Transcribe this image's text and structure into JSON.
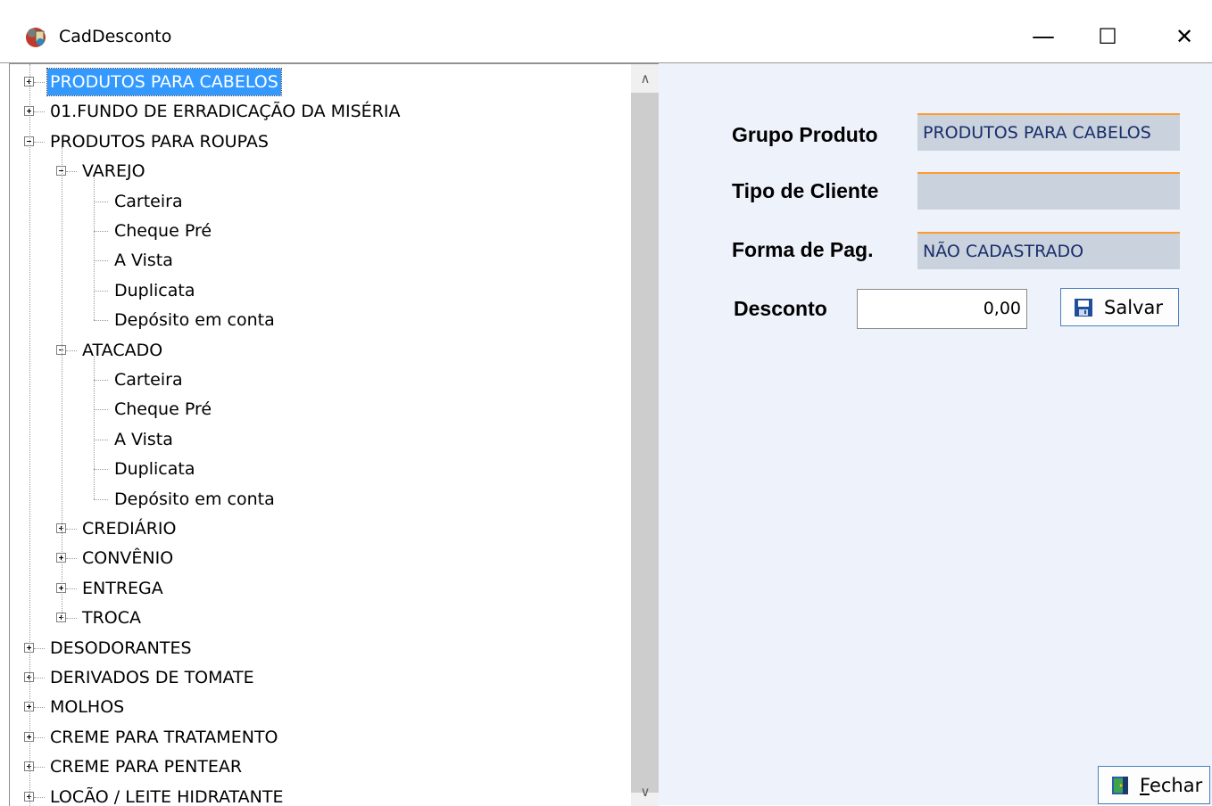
{
  "window": {
    "title": "CadDesconto",
    "controls": {
      "minimize": "—",
      "maximize": "☐",
      "close": "✕"
    }
  },
  "tree": {
    "items": [
      {
        "label": "PRODUTOS PARA CABELOS",
        "level": 0,
        "expander": "plus",
        "selected": true
      },
      {
        "label": "01.FUNDO DE ERRADICAÇÃO DA MISÉRIA",
        "level": 0,
        "expander": "plus"
      },
      {
        "label": "PRODUTOS PARA ROUPAS",
        "level": 0,
        "expander": "minus"
      },
      {
        "label": "VAREJO",
        "level": 1,
        "expander": "minus"
      },
      {
        "label": "Carteira",
        "level": 2
      },
      {
        "label": "Cheque Pré",
        "level": 2
      },
      {
        "label": "A Vista",
        "level": 2
      },
      {
        "label": "Duplicata",
        "level": 2
      },
      {
        "label": "Depósito em conta",
        "level": 2
      },
      {
        "label": "ATACADO",
        "level": 1,
        "expander": "minus"
      },
      {
        "label": "Carteira",
        "level": 2
      },
      {
        "label": "Cheque Pré",
        "level": 2
      },
      {
        "label": "A Vista",
        "level": 2
      },
      {
        "label": "Duplicata",
        "level": 2
      },
      {
        "label": "Depósito em conta",
        "level": 2
      },
      {
        "label": "CREDIÁRIO",
        "level": 1,
        "expander": "plus"
      },
      {
        "label": "CONVÊNIO",
        "level": 1,
        "expander": "plus"
      },
      {
        "label": "ENTREGA",
        "level": 1,
        "expander": "plus"
      },
      {
        "label": "TROCA",
        "level": 1,
        "expander": "plus"
      },
      {
        "label": "DESODORANTES",
        "level": 0,
        "expander": "plus"
      },
      {
        "label": "DERIVADOS DE TOMATE",
        "level": 0,
        "expander": "plus"
      },
      {
        "label": "MOLHOS",
        "level": 0,
        "expander": "plus"
      },
      {
        "label": "CREME PARA TRATAMENTO",
        "level": 0,
        "expander": "plus"
      },
      {
        "label": "CREME PARA PENTEAR",
        "level": 0,
        "expander": "plus"
      },
      {
        "label": "LOCÃO / LEITE HIDRATANTE",
        "level": 0,
        "expander": "plus"
      }
    ]
  },
  "scrollbar": {
    "up": "∧",
    "down": "∨"
  },
  "form": {
    "grupo_produto": {
      "label": "Grupo Produto",
      "value": "PRODUTOS PARA CABELOS"
    },
    "tipo_cliente": {
      "label": "Tipo de Cliente",
      "value": ""
    },
    "forma_pag": {
      "label": "Forma de Pag.",
      "value": "NÃO CADASTRADO"
    },
    "desconto": {
      "label": "Desconto",
      "value": "0,00"
    },
    "salvar": {
      "label": "Salvar"
    },
    "fechar": {
      "label_hotkey": "F",
      "label_rest": "echar"
    }
  },
  "colors": {
    "selection": "#3399ff",
    "panel_bg": "#eef2fb",
    "field_bg": "#c9d2dd",
    "field_accent": "#ff9a2e",
    "field_text": "#1a2e6c"
  }
}
